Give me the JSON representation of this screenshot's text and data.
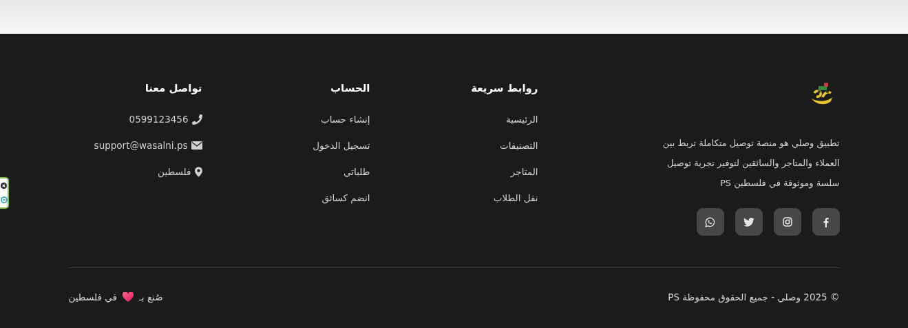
{
  "brand": {
    "description": "تطبيق وصلي هو منصة توصيل متكاملة تربط بين العملاء والمتاجر والسائقين لتوفير تجربة توصيل سلسة وموثوقة في فلسطين PS",
    "social_links": [
      {
        "kind": "facebook"
      },
      {
        "kind": "instagram"
      },
      {
        "kind": "twitter"
      },
      {
        "kind": "whatsapp"
      }
    ]
  },
  "columns": [
    {
      "title": "روابط سريعة",
      "links": [
        "الرئيسية",
        "التصنيفات",
        "المتاجر",
        "نقل الطلاب"
      ]
    },
    {
      "title": "الحساب",
      "links": [
        "إنشاء حساب",
        "تسجيل الدخول",
        "طلباتي",
        "انضم كسائق"
      ]
    }
  ],
  "contact": {
    "title": "تواصل معنا",
    "items": [
      {
        "kind": "phone",
        "text": "0599123456"
      },
      {
        "kind": "email",
        "text": "support@wasalni.ps"
      },
      {
        "kind": "location",
        "text": "فلسطين"
      }
    ]
  },
  "bottom": {
    "copyright": "© 2025 وصلي - جميع الحقوق محفوظة PS",
    "made_with": {
      "before": "صُنع بـ",
      "after": "في فلسطين"
    }
  }
}
